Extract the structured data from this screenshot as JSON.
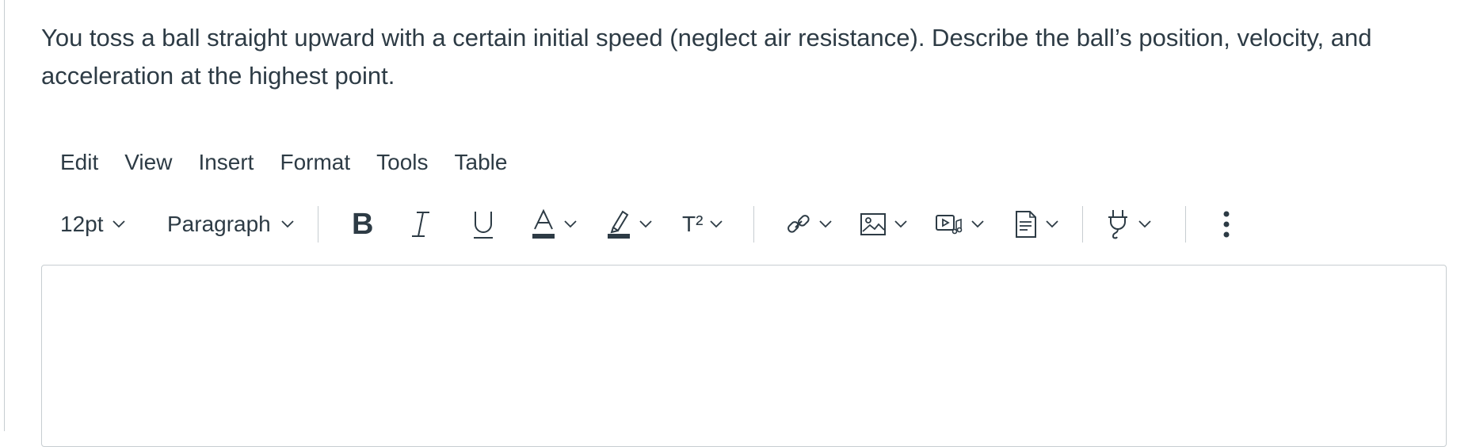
{
  "question": {
    "text": "You toss a ball straight upward with a certain initial speed (neglect air resistance).  Describe the ball’s position, velocity, and acceleration at the highest point."
  },
  "menubar": {
    "items": [
      "Edit",
      "View",
      "Insert",
      "Format",
      "Tools",
      "Table"
    ]
  },
  "toolbar": {
    "font_size": "12pt",
    "block_format": "Paragraph",
    "bold_label": "B",
    "italic_label": "I",
    "underline_label": "U",
    "text_color_label": "A",
    "superscript_label": "T²",
    "icons": [
      "chevron-down-icon",
      "bold-icon",
      "italic-icon",
      "underline-icon",
      "text-color-icon",
      "highlight-icon",
      "superscript-icon",
      "link-icon",
      "image-icon",
      "media-icon",
      "document-icon",
      "plugin-icon",
      "more-icon"
    ]
  },
  "editor": {
    "content": ""
  },
  "colors": {
    "text": "#2d3b45",
    "border": "#c7cdd1",
    "background": "#ffffff"
  }
}
